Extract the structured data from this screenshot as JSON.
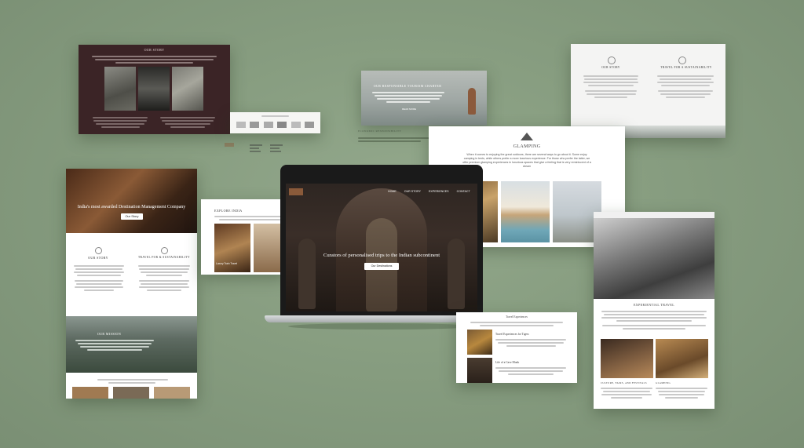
{
  "cards": {
    "ourstory_dark": {
      "title": "OUR STORY"
    },
    "charter": {
      "title": "OUR RESPONSIBLE TOURISM CHARTER",
      "sub": "ECONOMIC RESPONSIBILITY",
      "link": "READ MORE"
    },
    "travel_top": {
      "col1_title": "OUR STORY",
      "col2_title": "TRAVEL FOR A SUSTAINABILITY"
    },
    "glamping": {
      "title": "GLAMPING",
      "body": "When it comes to enjoying the great outdoors, there are several ways to go about it. Some enjoy camping in tents, while others prefer a more luxurious experience. For those who prefer the latter, we offer premium glamping experiences in luxurious spaces that give a feeling that is very reminiscent of a dream"
    },
    "left_page": {
      "hero_title": "India's most awarded Destination Management Company",
      "hero_btn": "Our Story",
      "col1_title": "OUR STORY",
      "col2_title": "TRAVEL FOR & SUSTAINABILITY",
      "mission_title": "OUR MISSION"
    },
    "explore": {
      "title": "EXPLORE INDIA",
      "caption1": "Luxury Train Travel"
    },
    "laptop": {
      "nav": [
        "HOME",
        "OUR STORY",
        "EXPERIENCES",
        "CONTACT"
      ],
      "hero_title": "Curators of personalised trips to the Indian subcontinent",
      "hero_btn": "Our Destinations"
    },
    "small_mid": {
      "title": "Travel Experiences",
      "item1": "Travel Experiences for Tigers",
      "item2": "Life of a Cave Monk"
    },
    "right_page": {
      "title": "EXPERIENTIAL TRAVEL",
      "caption1": "CULTURE, FAIRS, AND FESTIVALS",
      "caption2": "GLAMPING"
    }
  },
  "colors": {
    "background": "#879d80",
    "dark_card": "#3b2426",
    "dark_hero": "#2a2320"
  }
}
